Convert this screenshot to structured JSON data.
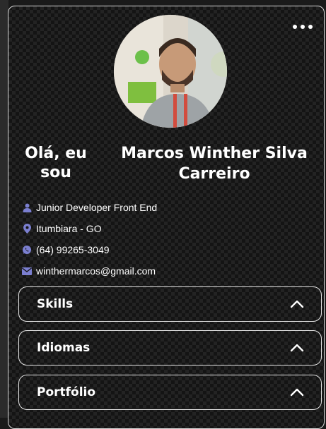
{
  "profile": {
    "greeting": "Olá, eu sou",
    "name": "Marcos Winther Silva Carreiro",
    "avatar_icon": "profile-photo"
  },
  "menu": {
    "icon": "more-dots-icon"
  },
  "info": [
    {
      "icon": "person-icon",
      "text": "Junior Developer Front End"
    },
    {
      "icon": "location-pin-icon",
      "text": "Itumbiara - GO"
    },
    {
      "icon": "whatsapp-icon",
      "text": "(64) 99265-3049"
    },
    {
      "icon": "mail-icon",
      "text": "winthermarcos@gmail.com"
    }
  ],
  "sections": [
    {
      "label": "Skills",
      "icon": "chevron-up-icon"
    },
    {
      "label": "Idiomas",
      "icon": "chevron-up-icon"
    },
    {
      "label": "Portfólio",
      "icon": "chevron-up-icon"
    }
  ],
  "colors": {
    "icon_accent": "#7b7fd0",
    "border": "#e6e6e6",
    "text": "#ffffff",
    "background": "#141414"
  }
}
